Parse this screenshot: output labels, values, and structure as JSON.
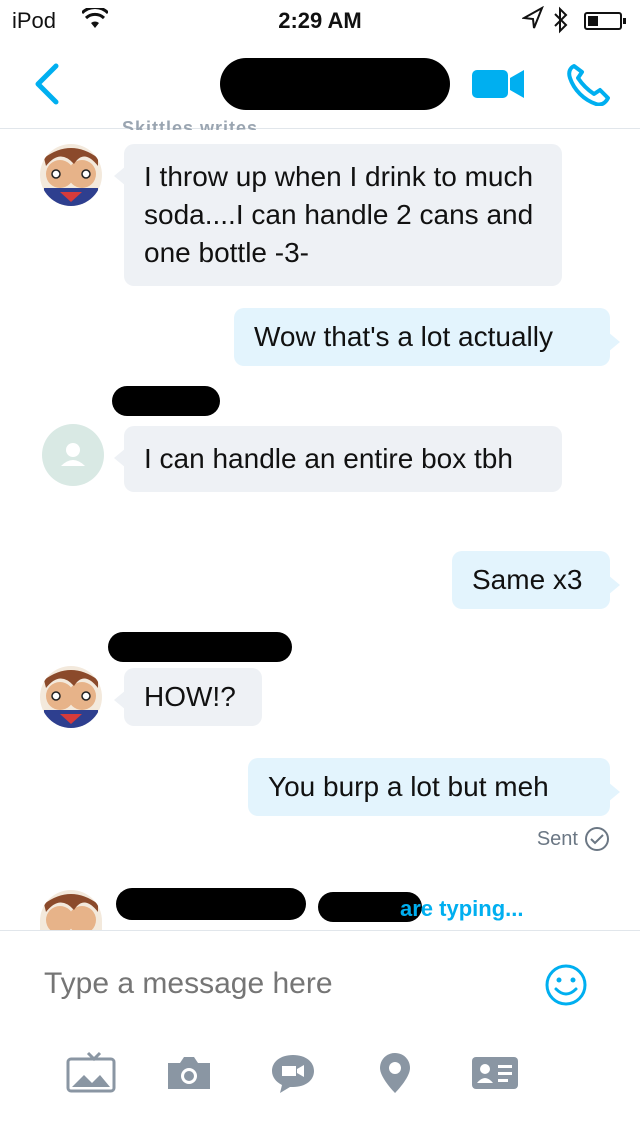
{
  "status_bar": {
    "carrier": "iPod",
    "time": "2:29 AM",
    "icons": [
      "wifi-icon",
      "location-icon",
      "bluetooth-icon",
      "battery-icon"
    ]
  },
  "nav": {
    "back_icon": "chevron-left-icon",
    "title": "[redacted]",
    "video_icon": "video-camera-icon",
    "call_icon": "phone-icon",
    "accent_color": "#00aff0"
  },
  "header_partial": "Skittles writes",
  "messages": [
    {
      "direction": "in",
      "avatar": "cartoon-avatar",
      "text": "I throw up when I drink to much soda....I can handle 2 cans and one bottle -3-"
    },
    {
      "direction": "out",
      "text": "Wow that's a lot actually"
    },
    {
      "direction": "in",
      "sender": "[redacted]",
      "avatar": "default-avatar",
      "text": "I can handle an entire box tbh"
    },
    {
      "direction": "out",
      "text": "Same x3"
    },
    {
      "direction": "in",
      "sender": "[redacted]",
      "avatar": "cartoon-avatar",
      "text": "HOW!?"
    },
    {
      "direction": "out",
      "text": "You burp a lot but meh"
    }
  ],
  "sent_status": "Sent",
  "typing_indicator": "are typing...",
  "composer": {
    "placeholder": "Type a message here",
    "emoji_icon": "smiley-icon",
    "toolbar": [
      "gallery-icon",
      "camera-icon",
      "video-message-icon",
      "location-pin-icon",
      "contact-card-icon"
    ]
  }
}
